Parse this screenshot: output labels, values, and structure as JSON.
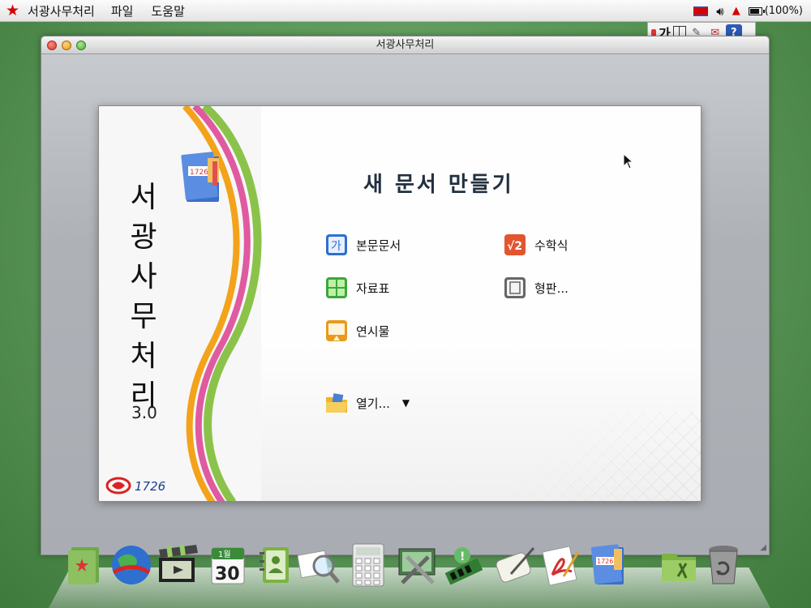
{
  "menubar": {
    "app_name": "서광사무처리",
    "items": [
      "파일",
      "도움말"
    ],
    "battery": "(100%)",
    "colors": {
      "star": "#d60000"
    }
  },
  "ime_toolbar": {
    "mode_label": "가"
  },
  "window": {
    "title": "서광사무처리"
  },
  "splash": {
    "vertical_title": [
      "서",
      "광",
      "사",
      "무",
      "처",
      "리"
    ],
    "version": "3.0",
    "heading": "새 문서 만들기",
    "options": {
      "document": "본문문서",
      "math": "수학식",
      "spreadsheet": "자료표",
      "template": "형판...",
      "presentation": "연시물",
      "open": "열기..."
    },
    "logo_text": "서광 logo"
  },
  "dock": {
    "items": [
      "photo-album",
      "browser",
      "video-player",
      "calendar",
      "contacts",
      "image-viewer",
      "calculator",
      "system-tools",
      "hardware-info",
      "text-editor",
      "pdf-reader",
      "office-suite",
      "file-manager",
      "trash"
    ],
    "calendar": {
      "month": "1월",
      "day": "30"
    }
  }
}
